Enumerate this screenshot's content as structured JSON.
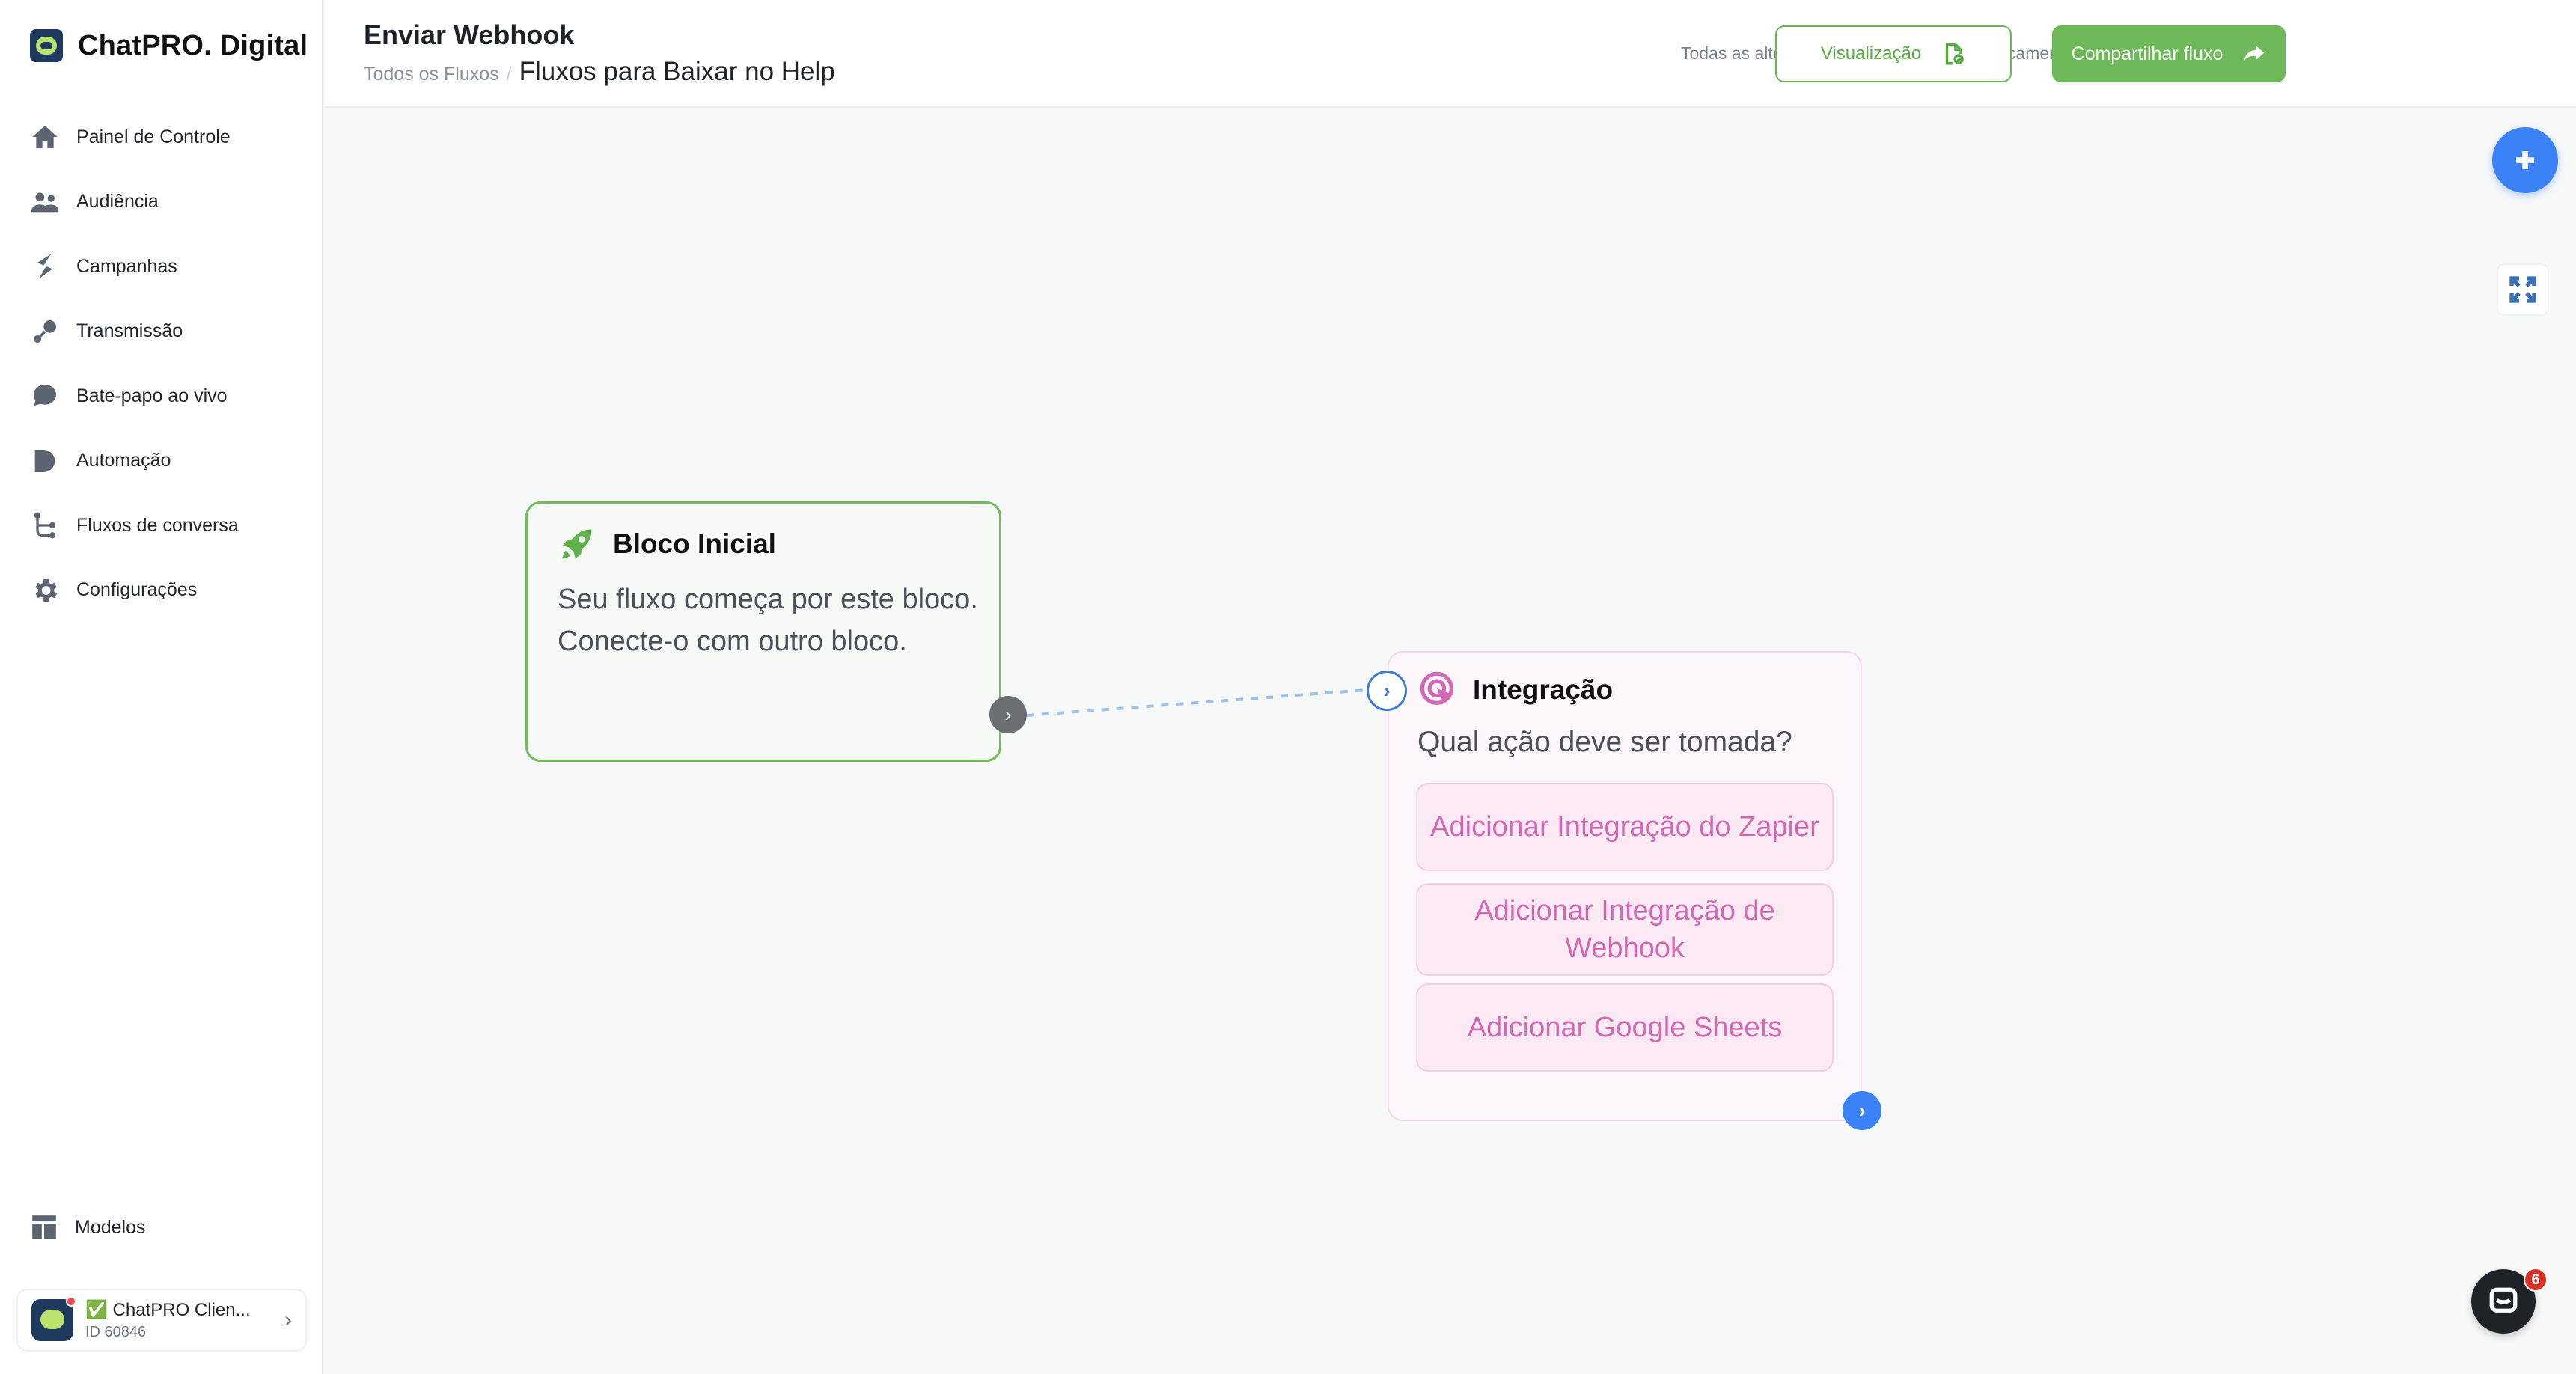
{
  "brand": {
    "name": "ChatPRO. Digital"
  },
  "sidebar": {
    "items": [
      {
        "label": "Painel de Controle",
        "icon": "home-icon"
      },
      {
        "label": "Audiência",
        "icon": "users-icon"
      },
      {
        "label": "Campanhas",
        "icon": "campaign-icon"
      },
      {
        "label": "Transmissão",
        "icon": "broadcast-icon"
      },
      {
        "label": "Bate-papo ao vivo",
        "icon": "chat-bubble-icon"
      },
      {
        "label": "Automação",
        "icon": "automation-icon"
      },
      {
        "label": "Fluxos de conversa",
        "icon": "flow-icon"
      },
      {
        "label": "Configurações",
        "icon": "gear-icon"
      }
    ],
    "models_label": "Modelos",
    "account": {
      "name": "✅ ChatPRO Clien...",
      "id": "ID 60846"
    }
  },
  "header": {
    "title": "Enviar Webhook",
    "breadcrumb_root": "Todos os Fluxos",
    "breadcrumb_sep": "/",
    "breadcrumb_current": "Fluxos para Baixar no Help",
    "autosave": "Todas as alterações foram salvas automaticamente",
    "preview_label": "Visualização",
    "share_label": "Compartilhar fluxo"
  },
  "canvas": {
    "start_block": {
      "title": "Bloco Inicial",
      "description": "Seu fluxo começa por este bloco. Conecte-o com outro bloco."
    },
    "integration_block": {
      "title": "Integração",
      "question": "Qual ação deve ser tomada?",
      "options": [
        "Adicionar Integração do Zapier",
        "Adicionar Integração de Webhook",
        "Adicionar Google Sheets"
      ]
    }
  },
  "chat_widget": {
    "badge": "6"
  },
  "colors": {
    "accent_green": "#6fb85a",
    "accent_blue": "#3b82f6",
    "integration_pink": "#d268b4"
  }
}
